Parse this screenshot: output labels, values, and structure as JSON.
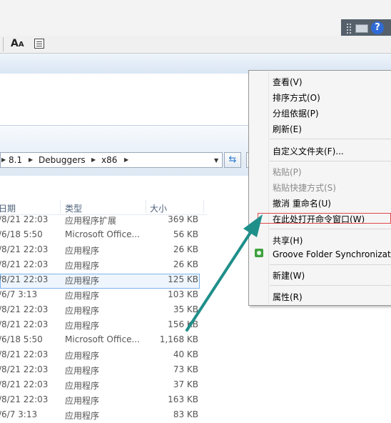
{
  "window": {
    "help_label": "?"
  },
  "toolbar": {
    "font_size_label_big": "A",
    "font_size_label_small": "A"
  },
  "address_bar": {
    "crumbs": [
      "8.1",
      "Debuggers",
      "x86"
    ]
  },
  "file_list": {
    "headers": {
      "date": "日期",
      "type": "类型",
      "size": "大小"
    },
    "rows": [
      {
        "date": "/8/21 22:03",
        "type": "应用程序扩展",
        "size": "369 KB"
      },
      {
        "date": "/6/18 5:50",
        "type": "Microsoft Office...",
        "size": "56 KB"
      },
      {
        "date": "/8/21 22:03",
        "type": "应用程序",
        "size": "26 KB"
      },
      {
        "date": "/8/21 22:03",
        "type": "应用程序",
        "size": "26 KB"
      },
      {
        "date": "/8/21 22:03",
        "type": "应用程序",
        "size": "125 KB"
      },
      {
        "date": "/6/7 3:13",
        "type": "应用程序",
        "size": "103 KB"
      },
      {
        "date": "/8/21 22:03",
        "type": "应用程序",
        "size": "35 KB"
      },
      {
        "date": "/8/21 22:03",
        "type": "应用程序",
        "size": "156 KB"
      },
      {
        "date": "/6/18 5:50",
        "type": "Microsoft Office...",
        "size": "1,168 KB"
      },
      {
        "date": "/8/21 22:03",
        "type": "应用程序",
        "size": "40 KB"
      },
      {
        "date": "/8/21 22:03",
        "type": "应用程序",
        "size": "73 KB"
      },
      {
        "date": "/8/21 22:03",
        "type": "应用程序",
        "size": "37 KB"
      },
      {
        "date": "/8/21 22:03",
        "type": "应用程序",
        "size": "163 KB"
      },
      {
        "date": "/6/7 3:13",
        "type": "应用程序",
        "size": "83 KB"
      }
    ]
  },
  "context_menu": {
    "view": "查看(V)",
    "sort_by": "排序方式(O)",
    "group_by": "分组依据(P)",
    "refresh": "刷新(E)",
    "customize_folder": "自定义文件夹(F)...",
    "paste": "粘贴(P)",
    "paste_shortcut": "粘贴快捷方式(S)",
    "undo_rename": "撤消 重命名(U)",
    "open_cmd_here": "在此处打开命令窗口(W)",
    "share": "共享(H)",
    "groove_sync": "Groove Folder Synchronization",
    "new": "新建(W)",
    "properties": "属性(R)"
  },
  "colors": {
    "highlight_border": "#e0474c",
    "arrow": "#1f8f8a",
    "selection_border": "#7eb4ea"
  }
}
